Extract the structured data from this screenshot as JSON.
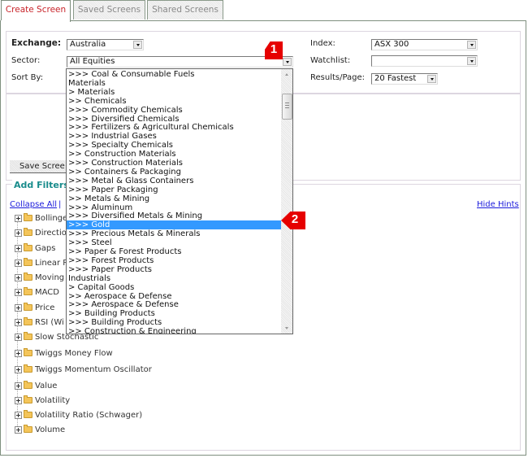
{
  "tabs": [
    {
      "label": "Create Screen",
      "active": true
    },
    {
      "label": "Saved Screens",
      "active": false
    },
    {
      "label": "Shared Screens",
      "active": false
    }
  ],
  "criteria": {
    "exchange_label": "Exchange:",
    "exchange_value": "Australia",
    "sector_label": "Sector:",
    "sector_value": "All Equities",
    "sortby_label": "Sort By:",
    "index_label": "Index:",
    "index_value": "ASX 300",
    "watchlist_label": "Watchlist:",
    "watchlist_value": "",
    "results_label": "Results/Page:",
    "results_value": "20 Fastest"
  },
  "save_button": "Save Scree",
  "filters": {
    "title": "Add Filters",
    "collapse_all": "Collapse All",
    "separator": "|",
    "hide_hints": "Hide Hints",
    "items": [
      "Bollinge",
      "Directio",
      "Gaps",
      "Linear R",
      "Moving",
      "MACD",
      "Price",
      "RSI (Wi",
      "Slow Stochastic",
      "Twiggs Money Flow",
      "Twiggs Momentum Oscillator",
      "Value",
      "Volatility",
      "Volatility Ratio (Schwager)",
      "Volume"
    ]
  },
  "sector_dropdown": {
    "selected_index": 17,
    "items": [
      ">>> Coal & Consumable Fuels",
      "Materials",
      "> Materials",
      ">> Chemicals",
      ">>> Commodity Chemicals",
      ">>> Diversified Chemicals",
      ">>> Fertilizers & Agricultural Chemicals",
      ">>> Industrial Gases",
      ">>> Specialty Chemicals",
      ">> Construction Materials",
      ">>> Construction Materials",
      ">> Containers & Packaging",
      ">>> Metal & Glass Containers",
      ">>> Paper Packaging",
      ">> Metals & Mining",
      ">>> Aluminum",
      ">>> Diversified Metals & Mining",
      ">>> Gold",
      ">>> Precious Metals & Minerals",
      ">>> Steel",
      ">> Paper & Forest Products",
      ">>> Forest Products",
      ">>> Paper Products",
      "Industrials",
      "> Capital Goods",
      ">> Aerospace & Defense",
      ">>> Aerospace & Defense",
      ">> Building Products",
      ">>> Building Products",
      ">> Construction & Engineering"
    ]
  },
  "callouts": [
    {
      "number": "1",
      "color": "#e60000"
    },
    {
      "number": "2",
      "color": "#e60000"
    }
  ],
  "colors": {
    "active_tab_text": "#c8242a",
    "section_title": "#198c8c",
    "link": "#1a1adb",
    "selection": "#3399ff",
    "callout": "#e60000"
  }
}
